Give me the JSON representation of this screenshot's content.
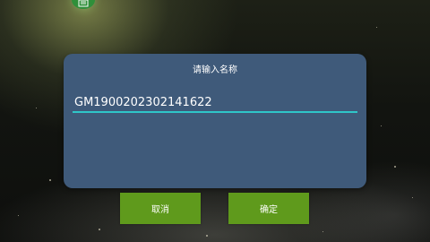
{
  "dialog": {
    "title": "请输入名称",
    "input_value": "GM1900202302141622"
  },
  "buttons": {
    "cancel_label": "取消",
    "confirm_label": "确定"
  },
  "app_icon": "tv-app-icon",
  "colors": {
    "dialog_background": "#3f5a7a",
    "input_underline": "#2fc6c9",
    "button_background": "#5f9a1c",
    "text": "#ffffff"
  }
}
